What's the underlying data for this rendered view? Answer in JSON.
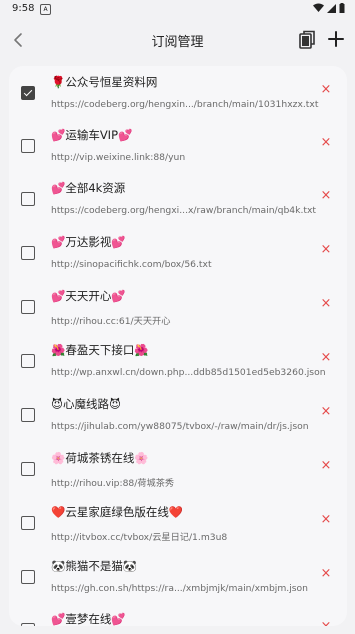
{
  "status_bar": {
    "time": "9:58",
    "left_icon": "A"
  },
  "header": {
    "title": "订阅管理"
  },
  "subscriptions": [
    {
      "name": "🌹公众号恒星资料网",
      "url": "https://codeberg.org/hengxin.../branch/main/1031hxzx.txt",
      "checked": true
    },
    {
      "name": "💕运输车VIP💕",
      "url": "http://vip.weixine.link:88/yun",
      "checked": false
    },
    {
      "name": "💕全部4k资源",
      "url": "https://codeberg.org/hengxi...x/raw/branch/main/qb4k.txt",
      "checked": false
    },
    {
      "name": "💕万达影视💕",
      "url": "http://sinopacifichk.com/box/56.txt",
      "checked": false
    },
    {
      "name": "💕天天开心💕",
      "url": "http://rihou.cc:61/天天开心",
      "checked": false
    },
    {
      "name": "🌺春盈天下接口🌺",
      "url": "http://wp.anxwl.cn/down.php...ddb85d1501ed5eb3260.json",
      "checked": false
    },
    {
      "name": "😈心魔线路😈",
      "url": "https://jihulab.com/yw88075/tvbox/-/raw/main/dr/js.json",
      "checked": false
    },
    {
      "name": "🌸荷城茶锈在线🌸",
      "url": "http://rihou.vip:88/荷城茶秀",
      "checked": false
    },
    {
      "name": "❤️云星家庭绿色版在线❤️",
      "url": "http://itvbox.cc/tvbox/云星日记/1.m3u8",
      "checked": false
    },
    {
      "name": "🐼熊猫不是猫🐼",
      "url": "https://gh.con.sh/https://ra.../xmbjmjk/main/xmbjm.json",
      "checked": false
    },
    {
      "name": "💕壹梦在线💕",
      "url": "",
      "checked": false
    }
  ],
  "delete_symbol": "×",
  "colors": {
    "accent_delete": "#e54848",
    "background": "#f2f2f4",
    "card": "#f7f7f9"
  }
}
